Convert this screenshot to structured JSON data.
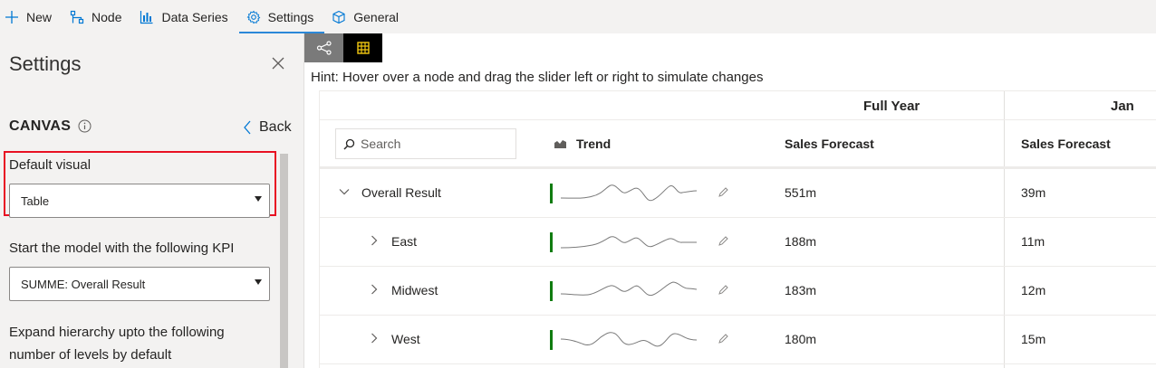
{
  "toolbar": {
    "items": [
      {
        "label": "New",
        "icon": "plus-icon"
      },
      {
        "label": "Node",
        "icon": "node-icon"
      },
      {
        "label": "Data Series",
        "icon": "bar-chart-icon"
      },
      {
        "label": "Settings",
        "icon": "gear-icon"
      },
      {
        "label": "General",
        "icon": "cube-icon"
      }
    ],
    "active": "Settings"
  },
  "settings_panel": {
    "title": "Settings",
    "section": "CANVAS",
    "back_label": "Back",
    "default_visual_label": "Default visual",
    "default_visual_value": "Table",
    "kpi_label": "Start the model with the following KPI",
    "kpi_value": "SUMME: Overall Result",
    "expand_label_line1": "Expand hierarchy upto the following",
    "expand_label_line2": "number of levels by default"
  },
  "hint": "Hint: Hover over a node and drag the slider left or right to simulate changes",
  "table": {
    "group_headers": [
      "Full Year",
      "Jan"
    ],
    "search_placeholder": "Search",
    "trend_header": "Trend",
    "column_headers": [
      "Sales Forecast",
      "Sales Forecast"
    ],
    "rows": [
      {
        "name": "Overall Result",
        "expanded": true,
        "full_year": "551m",
        "jan": "39m"
      },
      {
        "name": "East",
        "expanded": false,
        "full_year": "188m",
        "jan": "11m"
      },
      {
        "name": "Midwest",
        "expanded": false,
        "full_year": "183m",
        "jan": "12m"
      },
      {
        "name": "West",
        "expanded": false,
        "full_year": "180m",
        "jan": "15m"
      }
    ]
  },
  "colors": {
    "accent": "#2b88d8",
    "highlight_border": "#e81123",
    "trend_bar": "#107c10",
    "grid_icon": "#f2c811"
  }
}
